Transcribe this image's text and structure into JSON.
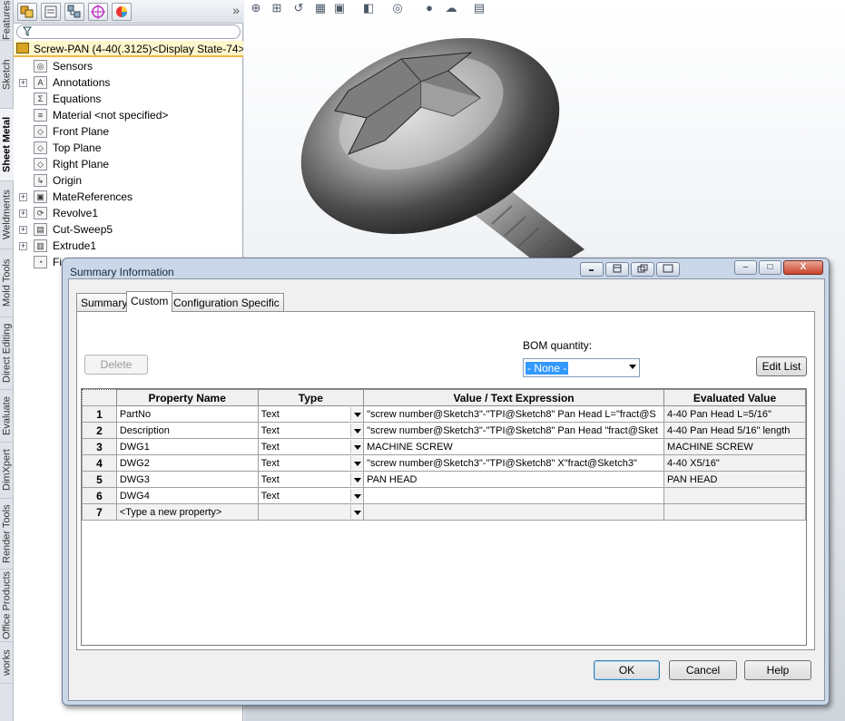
{
  "vertical_tabs": [
    "Features",
    "Sketch",
    "Sheet Metal",
    "Weldments",
    "Mold Tools",
    "Direct Editing",
    "Evaluate",
    "DimXpert",
    "Render Tools",
    "Office Products",
    "works"
  ],
  "feature_manager": {
    "toolbar_icons": [
      "feature-tree-icon",
      "property-manager-icon",
      "configuration-manager-icon",
      "dimxpert-icon",
      "display-manager-icon"
    ],
    "expand_glyph": "»",
    "filter_icon": "filter-icon",
    "root_label": "Screw-PAN  (4-40(.3125)<Display State-74>",
    "items": [
      {
        "label": "Sensors",
        "icon": "sensors-icon",
        "expand": ""
      },
      {
        "label": "Annotations",
        "icon": "annotations-icon",
        "expand": "+"
      },
      {
        "label": "Equations",
        "icon": "equations-icon",
        "expand": ""
      },
      {
        "label": "Material <not specified>",
        "icon": "material-icon",
        "expand": ""
      },
      {
        "label": "Front Plane",
        "icon": "plane-icon",
        "expand": ""
      },
      {
        "label": "Top Plane",
        "icon": "plane-icon",
        "expand": ""
      },
      {
        "label": "Right Plane",
        "icon": "plane-icon",
        "expand": ""
      },
      {
        "label": "Origin",
        "icon": "origin-icon",
        "expand": ""
      },
      {
        "label": "MateReferences",
        "icon": "mate-references-icon",
        "expand": "+"
      },
      {
        "label": "Revolve1",
        "icon": "revolve-icon",
        "expand": "+"
      },
      {
        "label": "Cut-Sweep5",
        "icon": "cut-sweep-icon",
        "expand": "+"
      },
      {
        "label": "Extrude1",
        "icon": "extrude-icon",
        "expand": "+"
      },
      {
        "label": "Fi",
        "icon": "fillet-icon",
        "expand": ""
      }
    ]
  },
  "view_toolbar": [
    "zoom-to-fit-icon",
    "zoom-to-area-icon",
    "previous-view-icon",
    "section-view-icon",
    "view-orientation-icon",
    "display-style-icon",
    "hide-show-items-icon",
    "edit-appearance-icon",
    "apply-scene-icon",
    "view-settings-icon"
  ],
  "dialog": {
    "title": "Summary Information",
    "tabs": [
      "Summary",
      "Custom",
      "Configuration Specific"
    ],
    "active_tab": "Custom",
    "delete_label": "Delete",
    "bom_label": "BOM quantity:",
    "bom_value": "- None -",
    "edit_list_label": "Edit List",
    "columns": [
      "Property Name",
      "Type",
      "Value / Text Expression",
      "Evaluated Value"
    ],
    "rows": [
      {
        "num": "1",
        "name": "PartNo",
        "type": "Text",
        "value": "\"screw number@Sketch3\"-\"TPI@Sketch8\" Pan Head L=\"fract@S",
        "evaluated": "4-40 Pan Head L=5/16\""
      },
      {
        "num": "2",
        "name": "Description",
        "type": "Text",
        "value": "\"screw number@Sketch3\"-\"TPI@Sketch8\" Pan Head \"fract@Sket",
        "evaluated": "4-40 Pan Head 5/16\" length"
      },
      {
        "num": "3",
        "name": "DWG1",
        "type": "Text",
        "value": "MACHINE SCREW",
        "evaluated": "MACHINE SCREW"
      },
      {
        "num": "4",
        "name": "DWG2",
        "type": "Text",
        "value": "\"screw number@Sketch3\"-\"TPI@Sketch8\" X\"fract@Sketch3\"",
        "evaluated": "4-40 X5/16\""
      },
      {
        "num": "5",
        "name": "DWG3",
        "type": "Text",
        "value": "PAN HEAD",
        "evaluated": "PAN HEAD"
      },
      {
        "num": "6",
        "name": "DWG4",
        "type": "Text",
        "value": "",
        "evaluated": ""
      },
      {
        "num": "7",
        "name": "<Type a new property>",
        "type": "",
        "value": "",
        "evaluated": ""
      }
    ],
    "ok_label": "OK",
    "cancel_label": "Cancel",
    "help_label": "Help",
    "caption_glyphs": {
      "minimize": "–",
      "maximize": "□",
      "close": "X"
    }
  }
}
